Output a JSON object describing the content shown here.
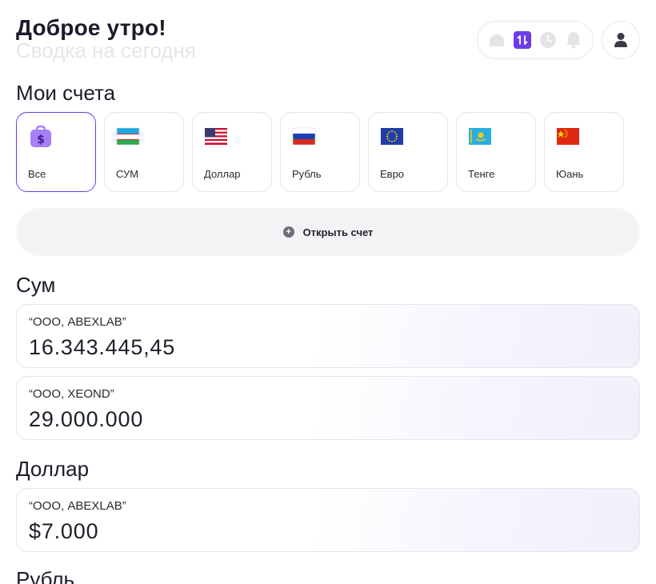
{
  "header": {
    "greeting": "Доброе утро!",
    "subtitle": "Сводка на сегодня"
  },
  "top_icons": [
    "home-icon",
    "transfer-icon",
    "history-icon",
    "bell-icon"
  ],
  "profile_icon": "user-icon",
  "accounts": {
    "title": "Мои счета",
    "items": [
      {
        "label": "Все",
        "icon": "wallet-icon"
      },
      {
        "label": "СУМ",
        "icon": "uzbekistan-flag-icon"
      },
      {
        "label": "Доллар",
        "icon": "usa-flag-icon"
      },
      {
        "label": "Рубль",
        "icon": "russia-flag-icon"
      },
      {
        "label": "Евро",
        "icon": "eu-flag-icon"
      },
      {
        "label": "Тенге",
        "icon": "kazakhstan-flag-icon"
      },
      {
        "label": "Юань",
        "icon": "china-flag-icon"
      }
    ],
    "open_button": "Открыть счет"
  },
  "sections": [
    {
      "title": "Сум",
      "cards": [
        {
          "org": "“ООО, ABEXLAB”",
          "amount": "16.343.445,45"
        },
        {
          "org": "“ООО, XEOND”",
          "amount": "29.000.000"
        }
      ]
    },
    {
      "title": "Доллар",
      "cards": [
        {
          "org": "“ООО, ABEXLAB”",
          "amount": "$7.000"
        }
      ]
    },
    {
      "title": "Рубль",
      "cards": []
    }
  ],
  "colors": {
    "accent": "#6a3de8",
    "muted_icon": "#e4e4e8",
    "card_border": "#e5e5ea"
  }
}
